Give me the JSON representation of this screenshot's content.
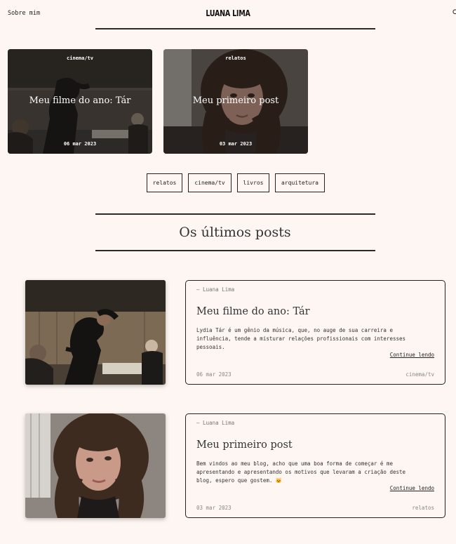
{
  "header": {
    "about_label": "Sobre mim",
    "logo": "LUANA LIMA",
    "search_icon": "search-icon"
  },
  "featured": [
    {
      "category": "cinema/tv",
      "title": "Meu filme do ano: Tár",
      "date": "06 mar 2023"
    },
    {
      "category": "relatos",
      "title": "Meu primeiro post",
      "date": "03 mar 2023"
    }
  ],
  "tags": [
    "relatos",
    "cinema/tv",
    "livros",
    "arquitetura"
  ],
  "latest": {
    "heading": "Os últimos posts",
    "posts": [
      {
        "author": "— Luana Lima",
        "title": "Meu filme do ano: Tár",
        "excerpt": "Lydia Tár é um gênio da música, que, no auge de sua carreira e influência, tende a misturar relações profissionais com interesses pessoais.",
        "more": "Continue lendo",
        "date": "06 mar 2023",
        "category": "cinema/tv"
      },
      {
        "author": "— Luana Lima",
        "title": "Meu primeiro post",
        "excerpt": "Bem vindos ao meu blog, acho que uma boa forma de começar é me apresentando e apresentando os motivos que levaram a criação deste blog, espero que gostem. 🐱",
        "more": "Continue lendo",
        "date": "03 mar 2023",
        "category": "relatos"
      }
    ]
  }
}
